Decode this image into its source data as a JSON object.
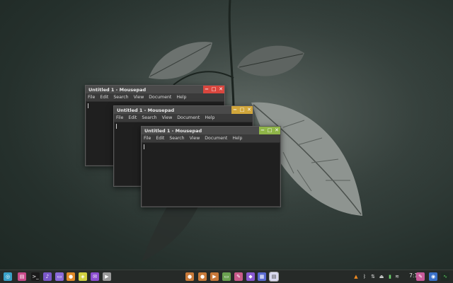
{
  "desktop": {
    "wallpaper": "leaf-wallpaper"
  },
  "windows": [
    {
      "title": "Untitled 1 - Mousepad",
      "accent": "#d9463e",
      "menu": [
        "File",
        "Edit",
        "Search",
        "View",
        "Document",
        "Help"
      ],
      "controls": {
        "minimize": "−",
        "maximize": "□",
        "close": "✕"
      }
    },
    {
      "title": "Untitled 1 - Mousepad",
      "accent": "#d1a63b",
      "menu": [
        "File",
        "Edit",
        "Search",
        "View",
        "Document",
        "Help"
      ],
      "controls": {
        "minimize": "−",
        "maximize": "□",
        "close": "✕"
      }
    },
    {
      "title": "Untitled 1 - Mousepad",
      "accent": "#8fb548",
      "menu": [
        "File",
        "Edit",
        "Search",
        "View",
        "Document",
        "Help"
      ],
      "controls": {
        "minimize": "−",
        "maximize": "□",
        "close": "✕"
      }
    }
  ],
  "taskbar": {
    "launchers": [
      {
        "name": "start-menu-icon",
        "color": "#3aa0c8"
      },
      {
        "name": "file-manager-icon",
        "color": "#c84a8a"
      },
      {
        "name": "terminal-icon",
        "color": "#1a1a1a"
      },
      {
        "name": "music-player-icon",
        "color": "#7a58c8"
      },
      {
        "name": "folder-icon",
        "color": "#8a6ad8"
      },
      {
        "name": "firefox-icon",
        "color": "#e08a2a"
      },
      {
        "name": "color-picker-icon",
        "color": "#d0d040"
      },
      {
        "name": "chat-icon",
        "color": "#8c4fd0"
      },
      {
        "name": "media-icon",
        "color": "#9a9a9a"
      }
    ],
    "center_apps": [
      {
        "name": "app-orange-icon",
        "color": "#c87a3a"
      },
      {
        "name": "app-orange2-icon",
        "color": "#c87a3a"
      },
      {
        "name": "app-play-icon",
        "color": "#c8783a"
      },
      {
        "name": "app-folder-icon",
        "color": "#6aa050"
      },
      {
        "name": "app-paint-icon",
        "color": "#c85a8a"
      },
      {
        "name": "app-purple-icon",
        "color": "#8a5ad0"
      },
      {
        "name": "app-blue-icon",
        "color": "#5a6ad0"
      },
      {
        "name": "app-mousepad-icon",
        "color": "#d8d8f0"
      }
    ],
    "tray": [
      "vlc-icon",
      "bluetooth-icon",
      "network-icon",
      "eject-icon",
      "battery-icon",
      "wifi-icon"
    ],
    "clock": "7:18"
  }
}
